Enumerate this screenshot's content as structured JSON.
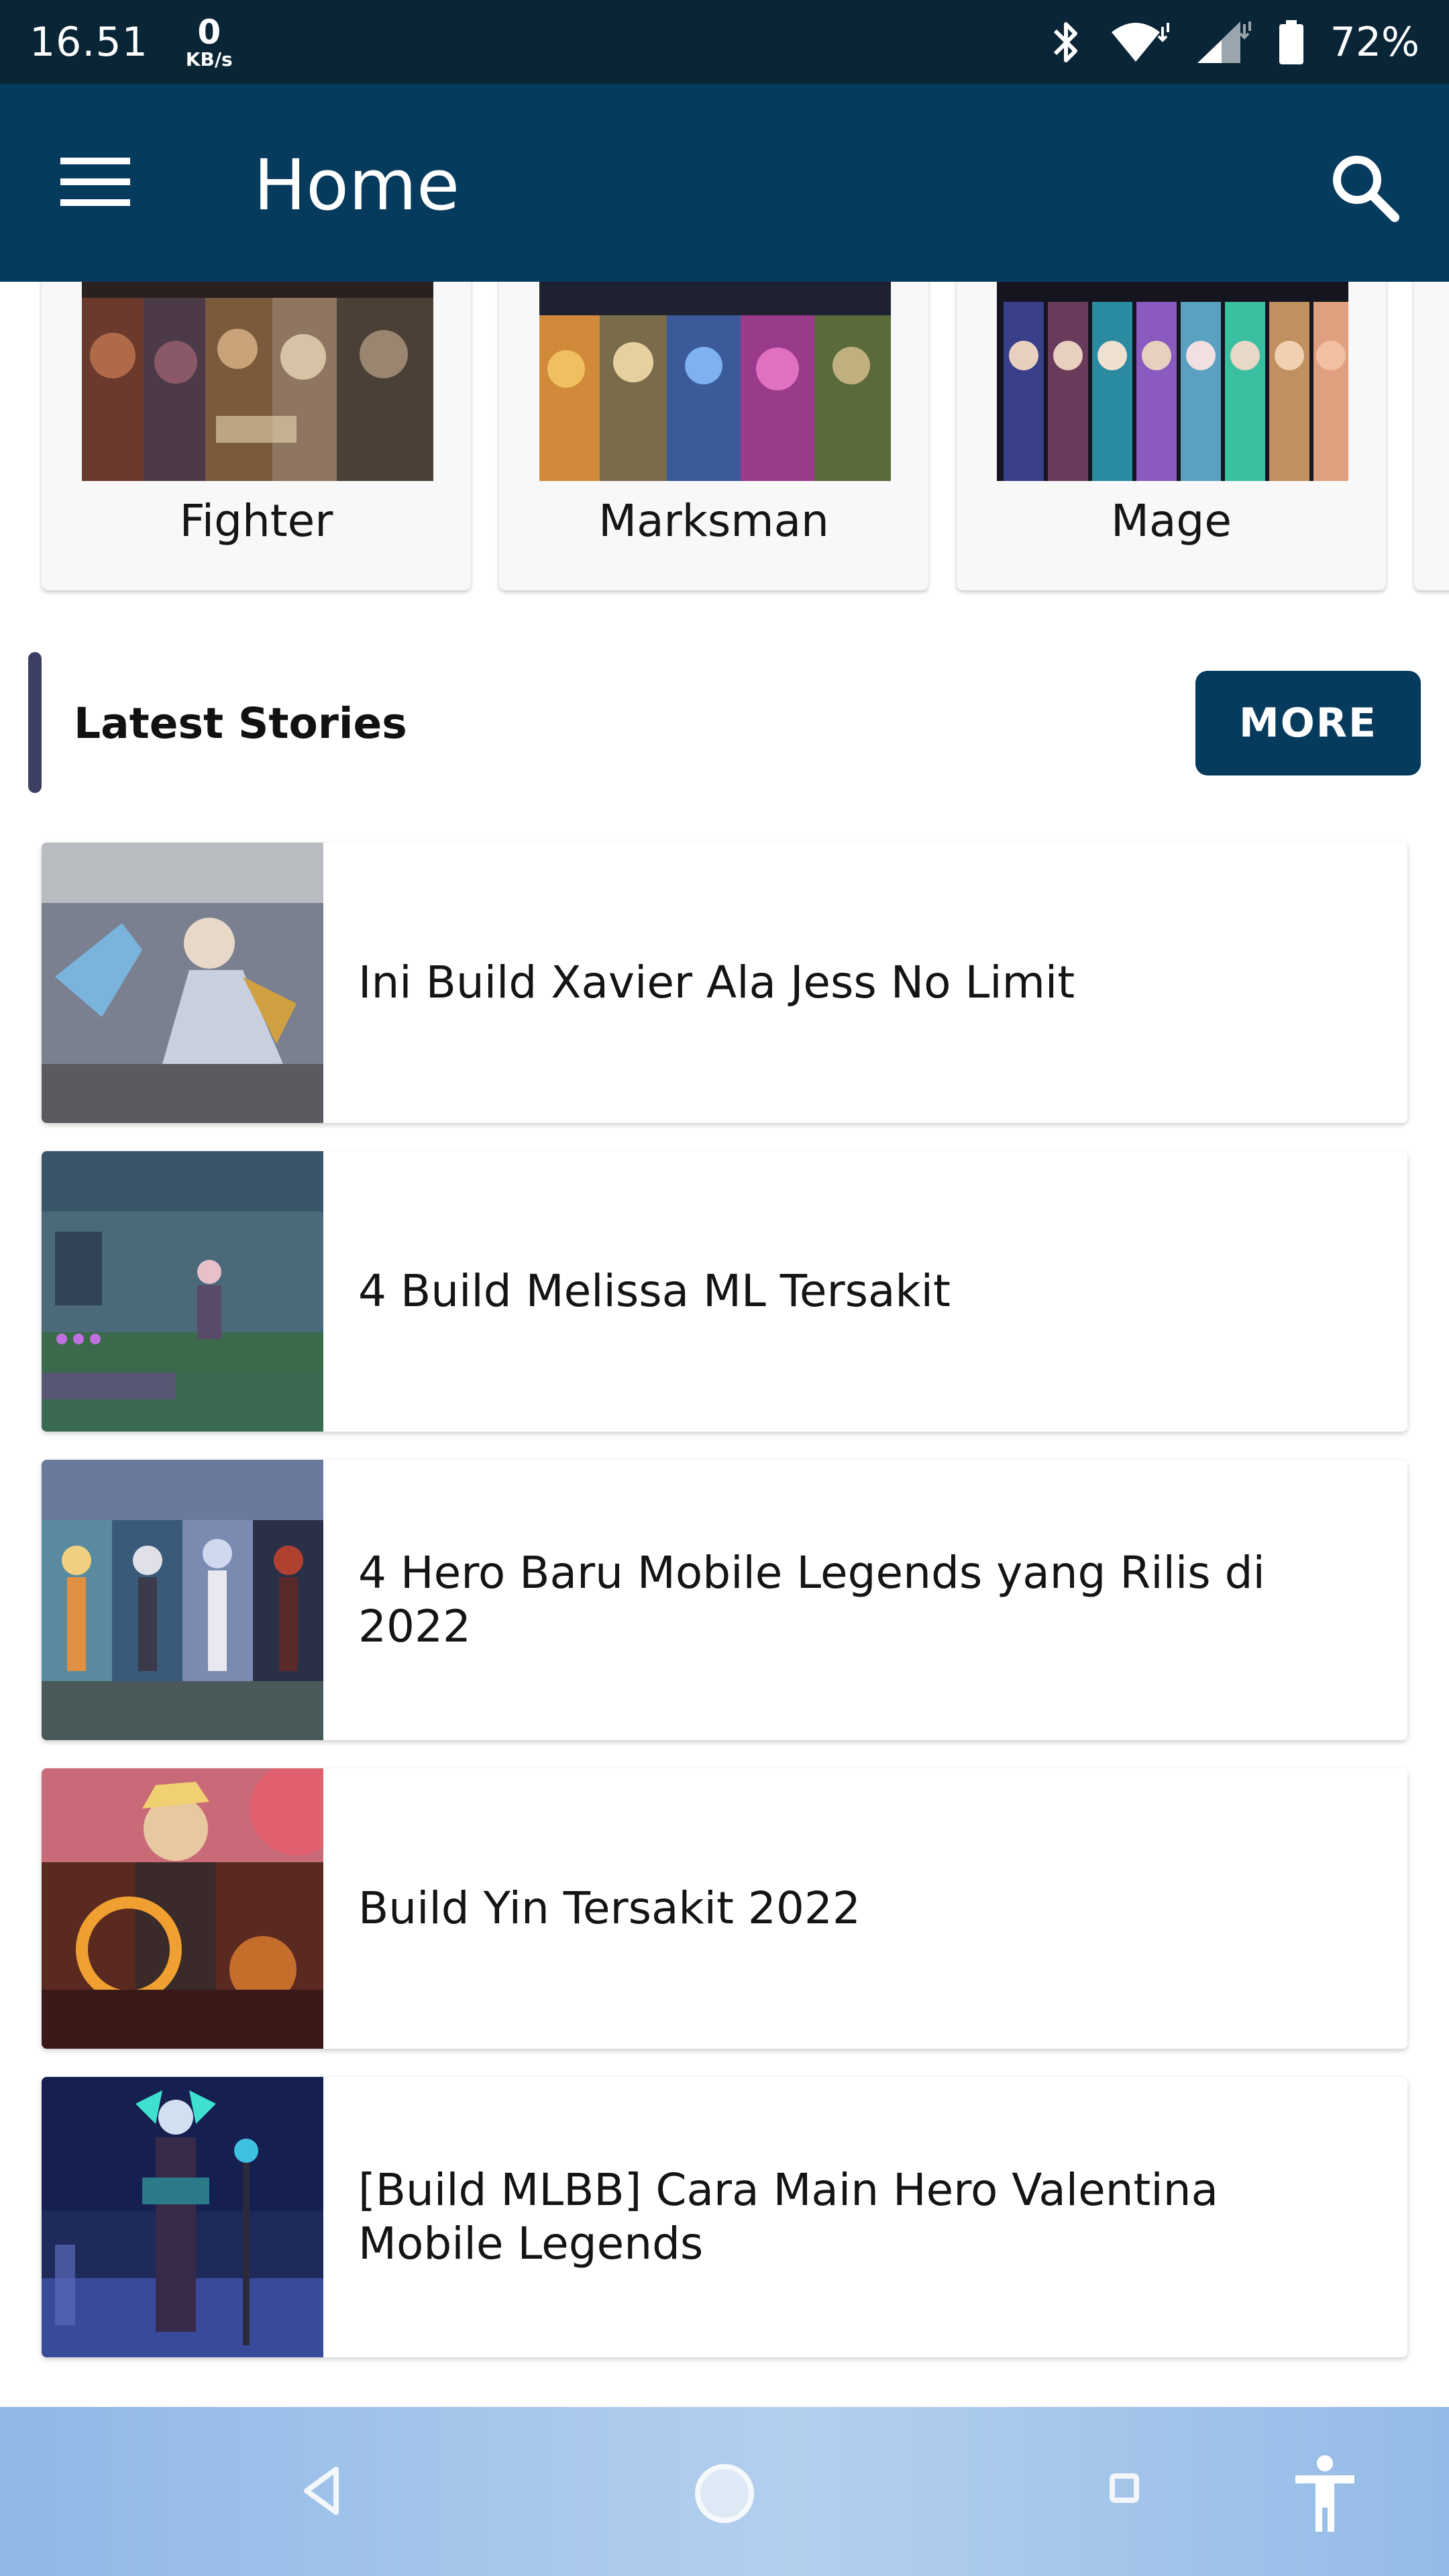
{
  "status": {
    "time": "16.51",
    "speed_value": "0",
    "speed_unit": "KB/s",
    "battery": "72%"
  },
  "app_bar": {
    "title": "Home"
  },
  "categories": [
    {
      "label": "Fighter"
    },
    {
      "label": "Marksman"
    },
    {
      "label": "Mage"
    }
  ],
  "latest": {
    "title": "Latest Stories",
    "more_label": "MORE",
    "stories": [
      {
        "title": "Ini Build Xavier Ala Jess No Limit"
      },
      {
        "title": "4 Build Melissa ML Tersakit"
      },
      {
        "title": "4 Hero Baru Mobile Legends yang Rilis di 2022"
      },
      {
        "title": "Build Yin Tersakit 2022"
      },
      {
        "title": "[Build MLBB] Cara Main Hero Valentina Mobile Legends"
      }
    ]
  },
  "colors": {
    "status_bar": "#0a2536",
    "app_bar": "#063b5e",
    "accent_bar": "#3b3f63",
    "nav_bar": "#a5c6ec"
  },
  "icons": [
    "menu-icon",
    "search-icon",
    "bluetooth-icon",
    "wifi-icon",
    "signal-icon",
    "battery-icon",
    "back-icon",
    "home-icon",
    "recents-icon",
    "accessibility-icon"
  ]
}
